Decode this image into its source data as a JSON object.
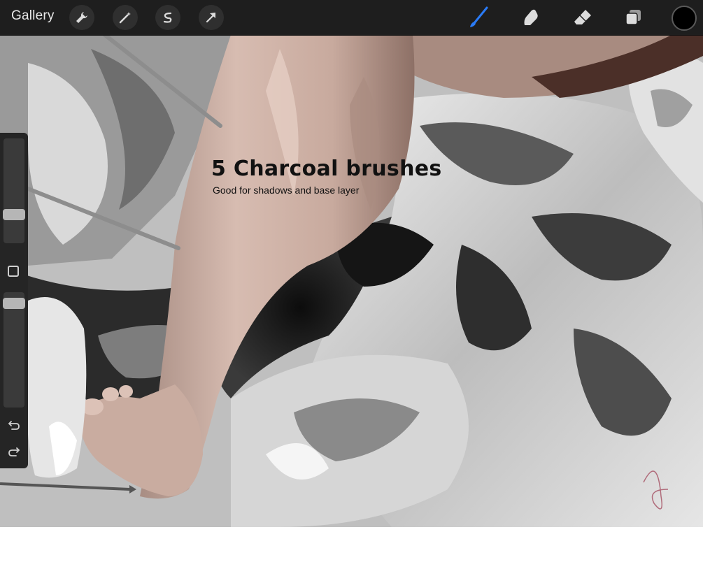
{
  "toolbar": {
    "gallery_label": "Gallery",
    "left_tools": [
      "wrench-icon",
      "magic-wand-icon",
      "selection-icon",
      "transform-arrow-icon"
    ],
    "right_tools": [
      "brush-icon",
      "smudge-icon",
      "eraser-icon",
      "layers-icon"
    ],
    "active_tool": "brush-icon",
    "active_color": "#000000",
    "accent_color": "#2a7bf6"
  },
  "sidebar": {
    "brush_size_level": 0.25,
    "opacity_level": 1.0,
    "undo_icon": "undo-icon",
    "redo_icon": "redo-icon"
  },
  "overlay": {
    "headline": "5 Charcoal brushes",
    "subline": "Good for shadows and base layer"
  }
}
